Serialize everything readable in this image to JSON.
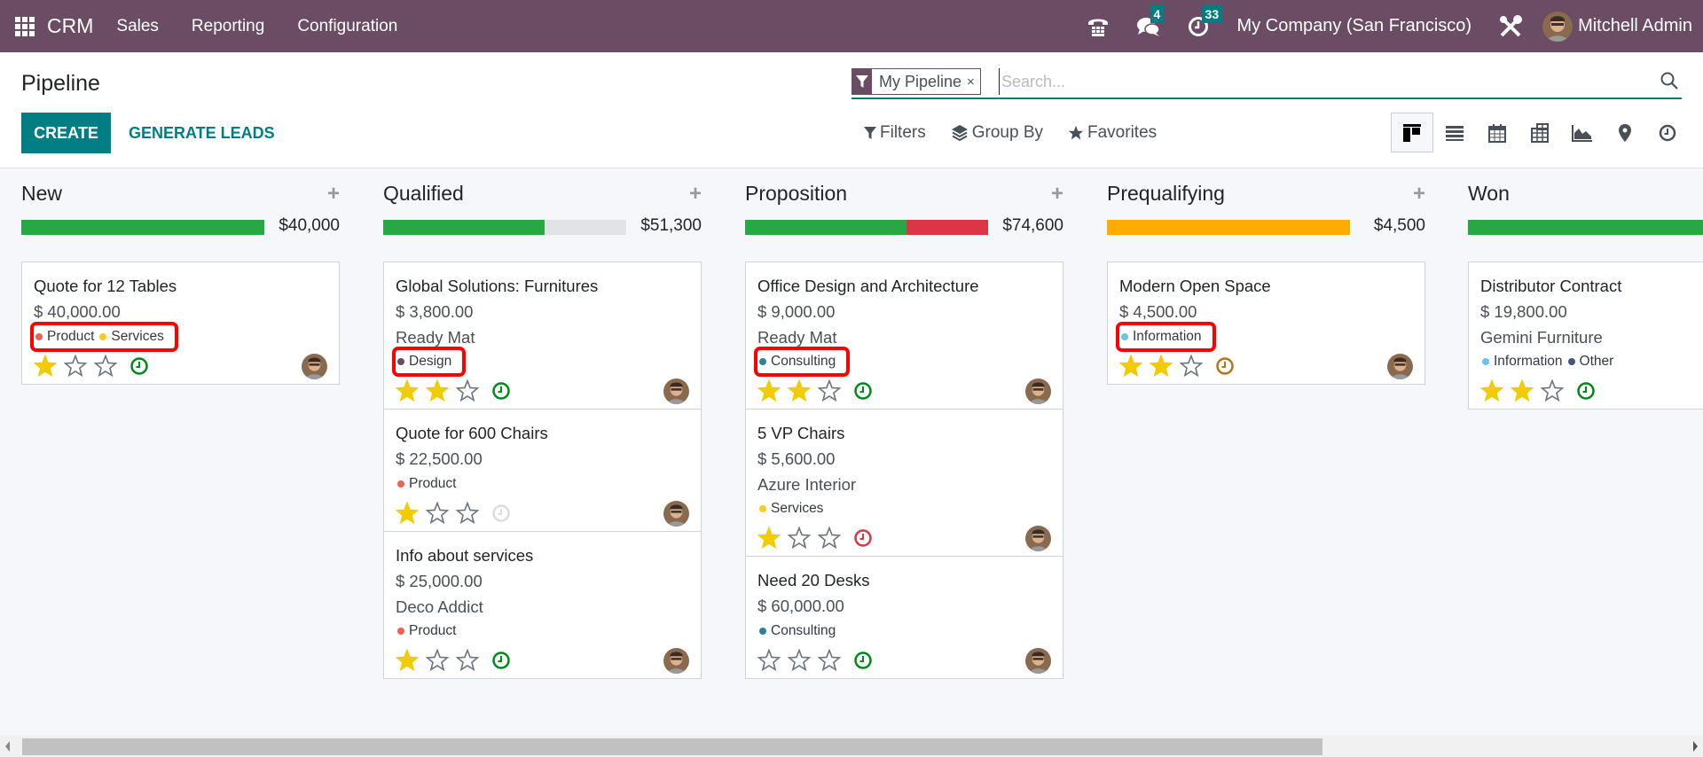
{
  "navbar": {
    "brand": "CRM",
    "menus": [
      "Sales",
      "Reporting",
      "Configuration"
    ],
    "messages_badge": "4",
    "activities_badge": "33",
    "company": "My Company (San Francisco)",
    "user": "Mitchell Admin",
    "bg_color": "#6b4c65"
  },
  "control_panel": {
    "title": "Pipeline",
    "create_label": "CREATE",
    "generate_label": "GENERATE LEADS",
    "search": {
      "facet_label": "My Pipeline",
      "facet_close": "×",
      "placeholder": "Search..."
    },
    "filters_label": "Filters",
    "groupby_label": "Group By",
    "favorites_label": "Favorites",
    "views": [
      "kanban",
      "list",
      "calendar",
      "pivot",
      "graph",
      "map",
      "activity"
    ],
    "active_view": "kanban",
    "accent": "#017e84"
  },
  "columns": [
    {
      "title": "New",
      "sum": "$40,000",
      "add_label": "+",
      "progress": [
        {
          "color": "#28a745",
          "fraction": 1.0
        }
      ],
      "cards": [
        {
          "title": "Quote for 12 Tables",
          "amount": "$ 40,000.00",
          "partner": "",
          "tags": [
            {
              "name": "Product",
              "color": "#f06050"
            },
            {
              "name": "Services",
              "color": "#f7cd1f"
            }
          ],
          "highlight_tags": true,
          "stars": 1,
          "activity": "green"
        }
      ]
    },
    {
      "title": "Qualified",
      "sum": "$51,300",
      "add_label": "+",
      "progress": [
        {
          "color": "#28a745",
          "fraction": 0.665
        }
      ],
      "cards": [
        {
          "title": "Global Solutions: Furnitures",
          "amount": "$ 3,800.00",
          "partner": "Ready Mat",
          "tags": [
            {
              "name": "Design",
              "color": "#6c4b66"
            }
          ],
          "highlight_tags": true,
          "stars": 2,
          "activity": "green"
        },
        {
          "title": "Quote for 600 Chairs",
          "amount": "$ 22,500.00",
          "partner": "",
          "tags": [
            {
              "name": "Product",
              "color": "#f06050"
            }
          ],
          "highlight_tags": false,
          "stars": 1,
          "activity": "none"
        },
        {
          "title": "Info about services",
          "amount": "$ 25,000.00",
          "partner": "Deco Addict",
          "tags": [
            {
              "name": "Product",
              "color": "#f06050"
            }
          ],
          "highlight_tags": false,
          "stars": 1,
          "activity": "green"
        }
      ]
    },
    {
      "title": "Proposition",
      "sum": "$74,600",
      "add_label": "+",
      "progress": [
        {
          "color": "#28a745",
          "fraction": 0.665
        },
        {
          "color": "#dc3545",
          "fraction": 0.335
        }
      ],
      "cards": [
        {
          "title": "Office Design and Architecture",
          "amount": "$ 9,000.00",
          "partner": "Ready Mat",
          "tags": [
            {
              "name": "Consulting",
              "color": "#2c8397"
            }
          ],
          "highlight_tags": true,
          "stars": 2,
          "activity": "green"
        },
        {
          "title": "5 VP Chairs",
          "amount": "$ 5,600.00",
          "partner": "Azure Interior",
          "tags": [
            {
              "name": "Services",
              "color": "#f7cd1f"
            }
          ],
          "highlight_tags": false,
          "stars": 1,
          "activity": "red"
        },
        {
          "title": "Need 20 Desks",
          "amount": "$ 60,000.00",
          "partner": "",
          "tags": [
            {
              "name": "Consulting",
              "color": "#2c8397"
            }
          ],
          "highlight_tags": false,
          "stars": 0,
          "activity": "green"
        }
      ]
    },
    {
      "title": "Prequalifying",
      "sum": "$4,500",
      "add_label": "+",
      "progress": [
        {
          "color": "#ffac00",
          "fraction": 1.0
        }
      ],
      "cards": [
        {
          "title": "Modern Open Space",
          "amount": "$ 4,500.00",
          "partner": "",
          "tags": [
            {
              "name": "Information",
              "color": "#6cc1ed"
            }
          ],
          "highlight_tags": true,
          "stars": 2,
          "activity": "orange"
        }
      ]
    },
    {
      "title": "Won",
      "sum": "",
      "add_label": "",
      "progress": [
        {
          "color": "#28a745",
          "fraction": 1.0
        }
      ],
      "cards": [
        {
          "title": "Distributor Contract",
          "amount": "$ 19,800.00",
          "partner": "Gemini Furniture",
          "tags": [
            {
              "name": "Information",
              "color": "#6cc1ed"
            },
            {
              "name": "Other",
              "color": "#475577"
            }
          ],
          "highlight_tags": false,
          "stars": 2,
          "activity": "green"
        }
      ]
    }
  ],
  "activity_colors": {
    "green": "#00881a",
    "red": "#dc3545",
    "orange": "#b3761b",
    "none": "#dcdcdc"
  },
  "star_color": "#f3cc00",
  "scrollbar": {
    "position_fraction": 0.0,
    "visible_fraction": 0.77
  }
}
